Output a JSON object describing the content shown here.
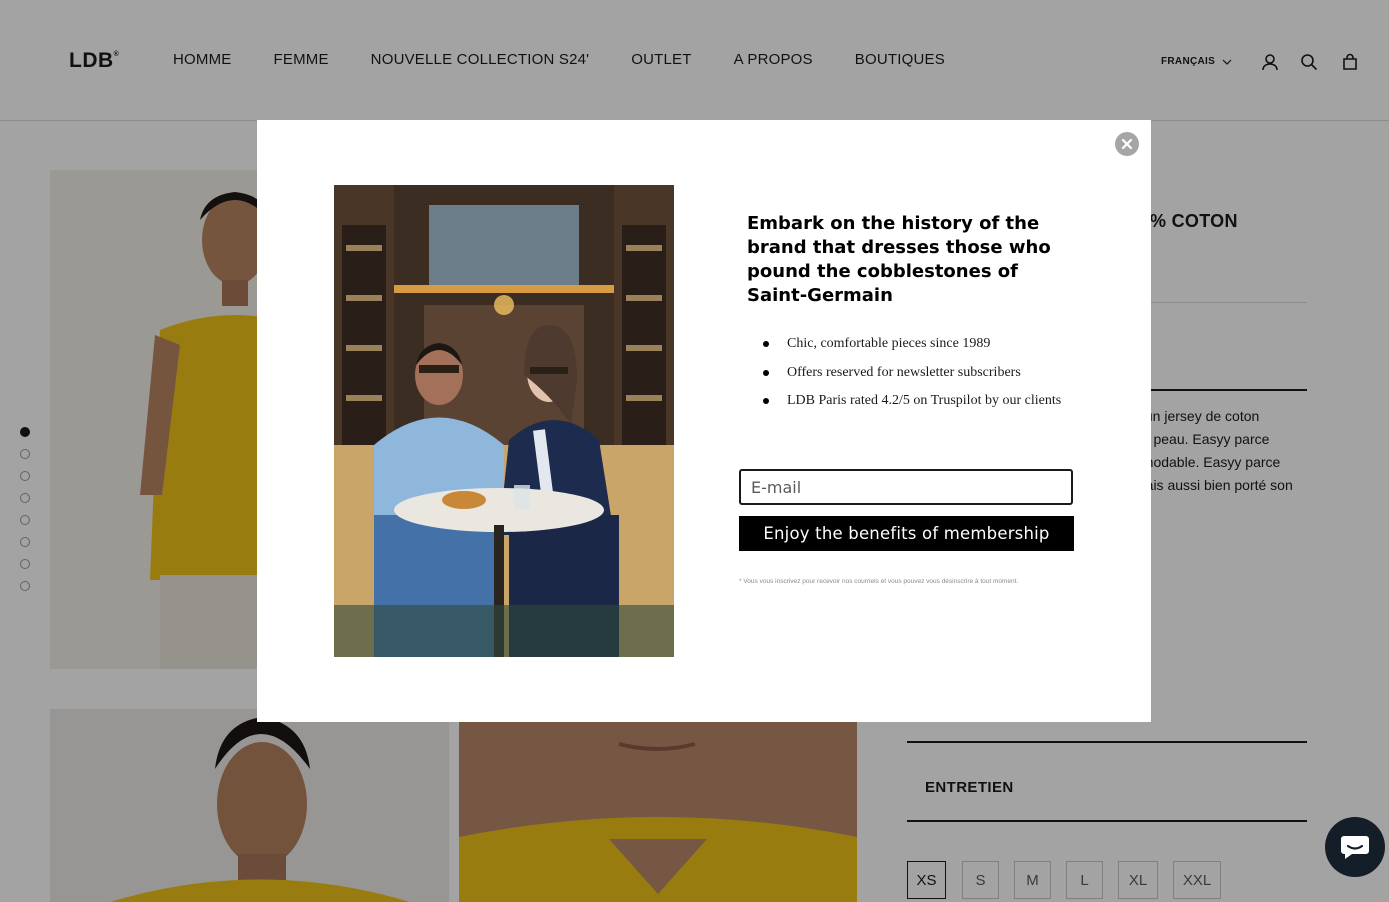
{
  "header": {
    "logo": "LDB",
    "nav": [
      "HOMME",
      "FEMME",
      "NOUVELLE COLLECTION S24'",
      "OUTLET",
      "A PROPOS",
      "BOUTIQUES"
    ],
    "language": "FRANÇAIS",
    "icons": [
      "account-icon",
      "search-icon",
      "cart-icon"
    ]
  },
  "product": {
    "title_fragment": "% COTON",
    "description_lines": [
      "s un jersey de coton",
      "de peau. Easyy parce",
      "émodable. Easyy parce",
      "mais aussi bien porté son"
    ],
    "section_entretien": "ENTRETIEN",
    "sizes": [
      "XS",
      "S",
      "M",
      "L",
      "XL",
      "XXL"
    ],
    "selected_size": "XS"
  },
  "gallery": {
    "slide_count": 8,
    "active_slide": 1
  },
  "popup": {
    "title": "Embark on the history of the brand that dresses those who pound the cobblestones of Saint-Germain",
    "bullets": [
      "Chic, comfortable pieces since 1989",
      "Offers reserved for newsletter subscribers",
      "LDB Paris rated 4.2/5 on Truspilot by our clients"
    ],
    "email_placeholder": "E-mail",
    "submit_label": "Enjoy the benefits of membership",
    "legal": "* Vous vous inscrivez pour recevoir nos courriels et vous pouvez vous désinscrire à tout moment."
  },
  "colors": {
    "accent": "#000000",
    "shirt_yellow": "#f0c21a",
    "chat_bg": "#141e28",
    "overlay": "rgba(0,0,0,0.36)"
  }
}
